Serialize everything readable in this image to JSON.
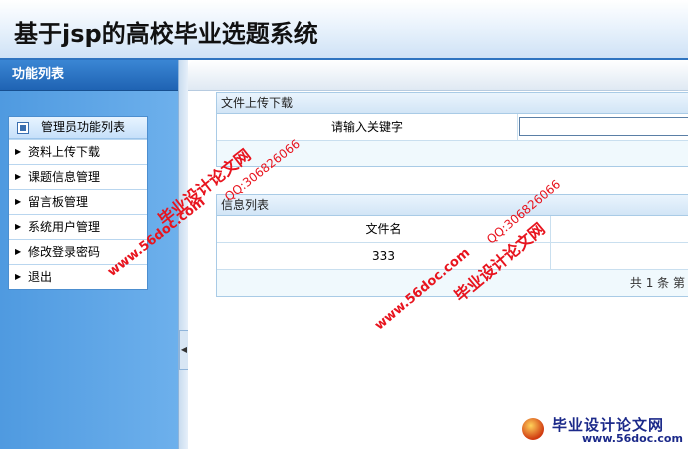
{
  "header": {
    "title": "基于jsp的高校毕业选题系统"
  },
  "sidebar": {
    "title": "功能列表",
    "menu_header": "管理员功能列表",
    "items": [
      {
        "label": "资料上传下载"
      },
      {
        "label": "课题信息管理"
      },
      {
        "label": "留言板管理"
      },
      {
        "label": "系统用户管理"
      },
      {
        "label": "修改登录密码"
      },
      {
        "label": "退出"
      }
    ]
  },
  "upload_panel": {
    "title": "文件上传下载",
    "keyword_label": "请输入关键字",
    "keyword_value": ""
  },
  "info_panel": {
    "title": "信息列表",
    "columns": [
      "文件名"
    ],
    "rows": [
      [
        "333"
      ]
    ],
    "footer": "共 1 条 第"
  },
  "watermarks": {
    "site_cn": "毕业设计论文网",
    "site_url": "www.56doc.com",
    "qq": "QQ:306826066"
  },
  "logo": {
    "cn": "毕业设计论文网",
    "en": "www.56doc.com"
  }
}
